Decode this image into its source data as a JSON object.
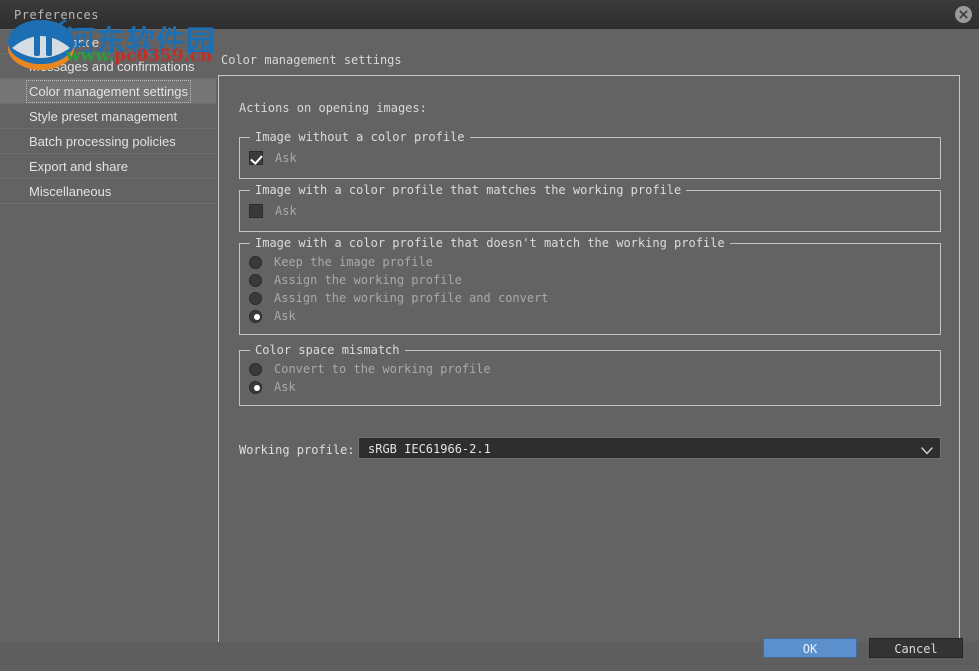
{
  "window": {
    "title": "Preferences",
    "close_icon": "close-icon"
  },
  "watermark": {
    "chinese": "河东软件园",
    "url_green": "www.",
    "url_red": "pc0359.cn"
  },
  "sidebar": {
    "items": [
      {
        "label": "Appearance",
        "selected": false
      },
      {
        "label": "Messages and confirmations",
        "selected": false
      },
      {
        "label": "Color management settings",
        "selected": true
      },
      {
        "label": "Style preset management",
        "selected": false
      },
      {
        "label": "Batch processing policies",
        "selected": false
      },
      {
        "label": "Export and share",
        "selected": false
      },
      {
        "label": "Miscellaneous",
        "selected": false
      }
    ]
  },
  "main": {
    "heading": "Color management settings",
    "actions_label": "Actions on opening images:",
    "groups": [
      {
        "title": "Image without a color profile",
        "type": "checkbox",
        "options": [
          {
            "label": "Ask",
            "checked": true
          }
        ]
      },
      {
        "title": "Image with a color profile that matches the working profile",
        "type": "checkbox",
        "options": [
          {
            "label": "Ask",
            "checked": false
          }
        ]
      },
      {
        "title": "Image with a color profile that doesn't match the working profile",
        "type": "radio",
        "options": [
          {
            "label": "Keep the image profile",
            "checked": false
          },
          {
            "label": "Assign the working profile",
            "checked": false
          },
          {
            "label": "Assign the working profile and convert",
            "checked": false
          },
          {
            "label": "Ask",
            "checked": true
          }
        ]
      },
      {
        "title": "Color space mismatch",
        "type": "radio",
        "options": [
          {
            "label": "Convert to the working profile",
            "checked": false
          },
          {
            "label": "Ask",
            "checked": true
          }
        ]
      }
    ],
    "working_profile": {
      "label": "Working profile:",
      "value": "sRGB IEC61966-2.1",
      "arrow_icon": "chevron-down-icon"
    }
  },
  "footer": {
    "ok_label": "OK",
    "cancel_label": "Cancel"
  },
  "colors": {
    "background": "#636363",
    "titlebar": "#343434",
    "accent": "#5b90cd",
    "border": "#c3c3c3",
    "text": "#d8d8d8",
    "muted_text": "#a9a9a9"
  }
}
